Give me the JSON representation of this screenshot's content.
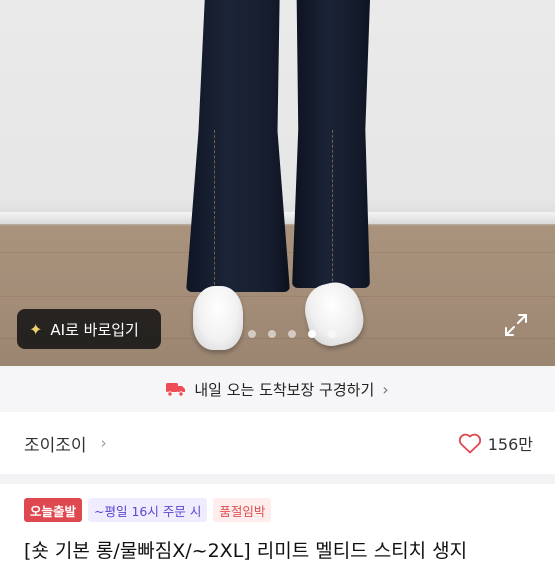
{
  "hero": {
    "ai_button_label": "AI로 바로입기",
    "pagination": {
      "total": 5,
      "active": 4
    },
    "icons": {
      "ai": "magic-wand-icon",
      "expand": "expand-icon"
    }
  },
  "delivery": {
    "label": "내일 오는 도착보장 구경하기",
    "icon": "truck-icon",
    "accent": "#ef4d55"
  },
  "seller": {
    "name": "조이조이",
    "likes": "156만",
    "heart_color": "#e0484f"
  },
  "badges": [
    {
      "label": "오늘출발"
    },
    {
      "label": "~평일 16시 주문 시"
    },
    {
      "label": "품절임박"
    }
  ],
  "product": {
    "title": "[숏 기본 롱/물빠짐X/~2XL] 리미트 멜티드 스티치 생지"
  }
}
